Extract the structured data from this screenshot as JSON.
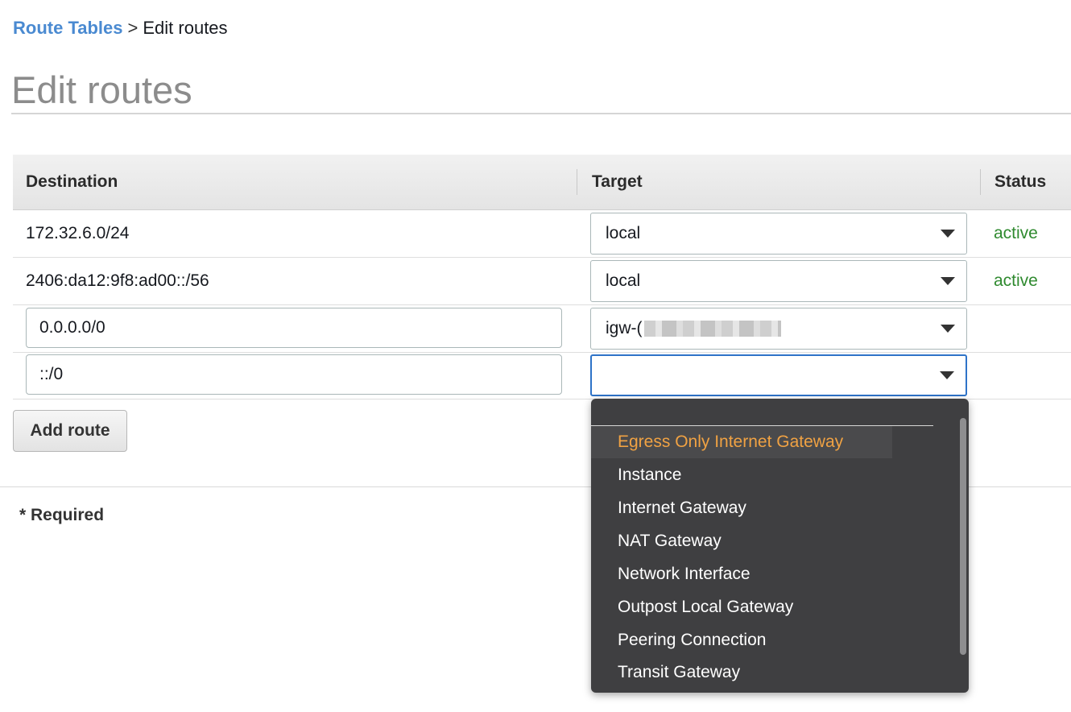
{
  "breadcrumb": {
    "parent": "Route Tables",
    "separator": ">",
    "current": "Edit routes"
  },
  "page_title": "Edit routes",
  "table": {
    "headers": {
      "destination": "Destination",
      "target": "Target",
      "status": "Status"
    },
    "rows": [
      {
        "destination": "172.32.6.0/24",
        "target": "local",
        "status": "active"
      },
      {
        "destination": "2406:da12:9f8:ad00::/56",
        "target": "local",
        "status": "active"
      },
      {
        "destination": "0.0.0.0/0",
        "target": "igw-(",
        "status": ""
      },
      {
        "destination": "::/0",
        "target": "",
        "status": ""
      }
    ]
  },
  "add_route_label": "Add route",
  "required_note": "* Required",
  "dropdown": {
    "options": [
      "Egress Only Internet Gateway",
      "Instance",
      "Internet Gateway",
      "NAT Gateway",
      "Network Interface",
      "Outpost Local Gateway",
      "Peering Connection",
      "Transit Gateway"
    ],
    "highlighted_index": 0
  },
  "colors": {
    "link": "#4a8ad1",
    "status_active": "#2f8a2f",
    "dropdown_bg": "#3f3f41",
    "dropdown_highlight_text": "#f0a243",
    "focus_border": "#2e73c8"
  },
  "icons": {
    "select_caret": "caret-down-icon"
  }
}
